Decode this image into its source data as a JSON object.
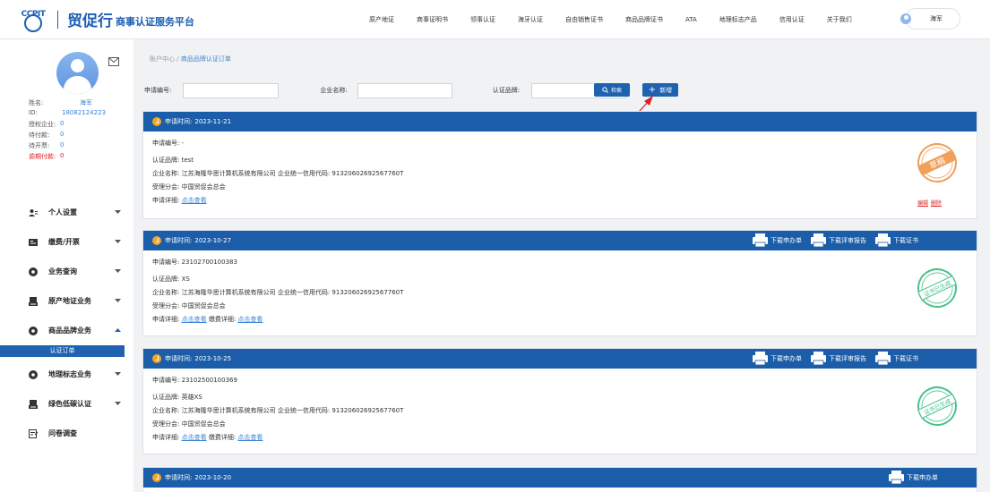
{
  "header": {
    "logo_mark": "CCPIT",
    "logo_title": "贸促行",
    "logo_subtitle": "商事认证服务平台",
    "nav": [
      "原产地证",
      "商事证明书",
      "领事认证",
      "海牙认证",
      "自由销售证书",
      "商品品牌证书",
      "ATA",
      "地理标志产品",
      "信用认证",
      "关于我们"
    ],
    "user_name": "海军"
  },
  "sidebar": {
    "profile": {
      "name_label": "姓名:",
      "name_value": "海军",
      "id_label": "ID:",
      "id_value": "18082124223",
      "auth_label": "授权企业:",
      "auth_value": "0",
      "pay_label": "待付款:",
      "pay_value": "0",
      "invoice_label": "待开票:",
      "invoice_value": "0",
      "overdue_label": "逾期付款:",
      "overdue_value": "0"
    },
    "menu": [
      {
        "label": "个人设置",
        "icon": "user-settings-icon"
      },
      {
        "label": "缴费/开票",
        "icon": "invoice-icon"
      },
      {
        "label": "业务查询",
        "icon": "query-icon"
      },
      {
        "label": "原产地证业务",
        "icon": "certificate-icon"
      },
      {
        "label": "商品品牌业务",
        "icon": "brand-icon"
      },
      {
        "label": "地理标志业务",
        "icon": "geo-icon"
      },
      {
        "label": "绿色低碳认证",
        "icon": "green-icon"
      },
      {
        "label": "问卷调查",
        "icon": "survey-icon"
      }
    ],
    "active_sub": "认证订单"
  },
  "breadcrumb": {
    "root": "账户中心",
    "sep": "/",
    "current": "商品品牌认证订单"
  },
  "filters": {
    "apply_no_label": "申请编号:",
    "apply_no_value": "",
    "company_label": "企业名称:",
    "company_value": "",
    "brand_label": "认证品牌:",
    "brand_value": "",
    "search_button": "检索",
    "add_button": "新增"
  },
  "labels": {
    "apply_time": "申请时间:",
    "apply_no": "申请编号:",
    "brand": "认证品牌:",
    "company": "企业名称:",
    "credit_code": "企业统一信用代码:",
    "branch": "受理分会:",
    "detail": "申请详细:",
    "view": "点击查看",
    "fee_detail": "缴费详细:",
    "download_form": "下载申办单",
    "download_review": "下载评审报告",
    "download_cert": "下载证书",
    "edit": "编辑",
    "delete": "删除"
  },
  "orders": [
    {
      "time": "2023-11-21",
      "apply_no": "-",
      "brand": "test",
      "company": "江苏海隆华思计算机系统有限公司",
      "credit_code": "91320602692567760T",
      "branch": "中国贸促会总会",
      "status": "草稿"
    },
    {
      "time": "2023-10-27",
      "apply_no": "23102700100383",
      "brand": "XS",
      "company": "江苏海隆华思计算机系统有限公司",
      "credit_code": "91320602692567760T",
      "branch": "中国贸促会总会",
      "status": "证书已生成"
    },
    {
      "time": "2023-10-25",
      "apply_no": "23102500100369",
      "brand": "英雄XS",
      "company": "江苏海隆华思计算机系统有限公司",
      "credit_code": "91320602692567760T",
      "branch": "中国贸促会总会",
      "status": "证书已生成"
    },
    {
      "time": "2023-10-20"
    }
  ],
  "colors": {
    "primary": "#1b5da8",
    "link": "#3a85d6",
    "danger": "#e02020",
    "stamp_draft": "#f0a05a",
    "stamp_done": "#4bc28a"
  }
}
